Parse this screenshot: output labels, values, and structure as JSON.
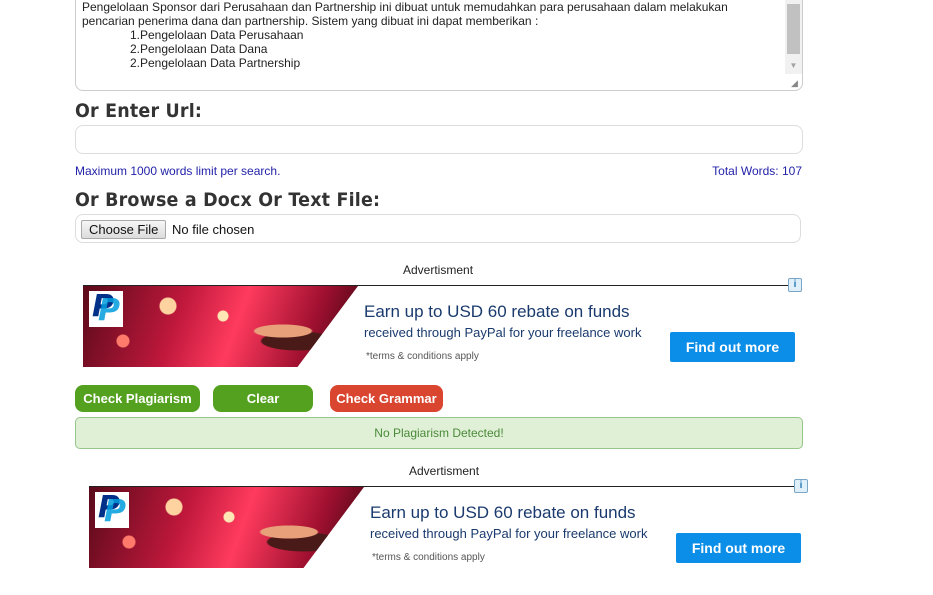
{
  "textarea": {
    "paragraph": "Pengelolaan Sponsor dari Perusahaan dan Partnership ini dibuat untuk memudahkan para perusahaan dalam melakukan pencarian penerima dana dan partnership. Sistem yang dibuat ini dapat memberikan :",
    "list": [
      "1.Pengelolaan Data Perusahaan",
      "2.Pengelolaan Data Dana",
      "2.Pengelolaan Data Partnership"
    ]
  },
  "url_section": {
    "heading": "Or Enter Url:",
    "value": "",
    "placeholder": ""
  },
  "limits": {
    "max_words": "Maximum 1000 words limit per search.",
    "total_words": "Total Words: 107"
  },
  "file_section": {
    "heading": "Or Browse a Docx Or Text File:",
    "choose_label": "Choose File",
    "status": "No file chosen"
  },
  "ads": [
    {
      "label": "Advertisment",
      "headline": "Earn up to USD 60 rebate on funds",
      "subline": "received through PayPal for your freelance work",
      "terms": "*terms & conditions apply",
      "cta": "Find out more",
      "info_icon": "info-icon",
      "logo": "paypal-logo"
    },
    {
      "label": "Advertisment",
      "headline": "Earn up to USD 60 rebate on funds",
      "subline": "received through PayPal for your freelance work",
      "terms": "*terms & conditions apply",
      "cta": "Find out more",
      "info_icon": "info-icon",
      "logo": "paypal-logo"
    }
  ],
  "actions": {
    "check_plagiarism": "Check Plagiarism",
    "clear": "Clear",
    "check_grammar": "Check Grammar"
  },
  "result": {
    "message": "No Plagiarism Detected!"
  },
  "colors": {
    "green_button": "#54a120",
    "red_button": "#d9452f",
    "link_blue": "#2222aa",
    "result_bg": "#e0f0d6",
    "ad_cta": "#0b8ee8"
  }
}
